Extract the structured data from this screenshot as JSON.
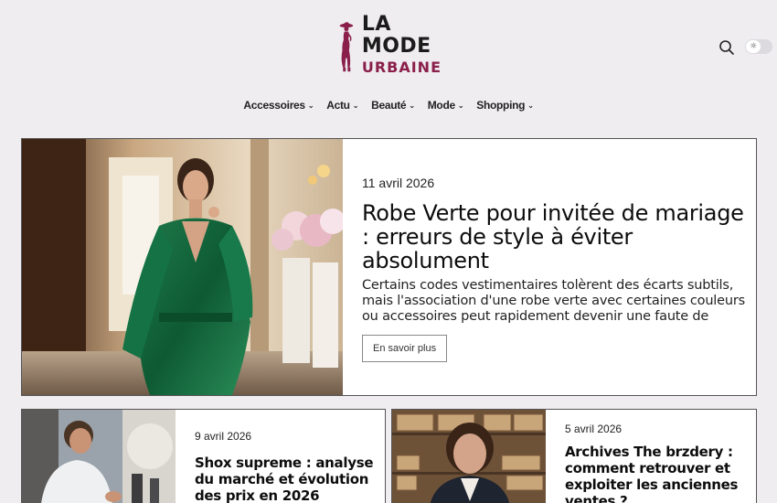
{
  "brand": {
    "line1": "LA",
    "line2": "MODE",
    "line3": "URBAINE",
    "accent_color": "#8a1f4b"
  },
  "header_actions": {
    "search_icon": "search-icon",
    "theme_icon": "sun-icon"
  },
  "nav": {
    "items": [
      {
        "label": "Accessoires"
      },
      {
        "label": "Actu"
      },
      {
        "label": "Beauté"
      },
      {
        "label": "Mode"
      },
      {
        "label": "Shopping"
      }
    ]
  },
  "featured": {
    "date": "11 avril 2026",
    "title": "Robe Verte pour invitée de mariage : erreurs de style à éviter absolument",
    "excerpt": "Certains codes vestimentaires tolèrent des écarts subtils, mais l'association d'une robe verte avec certaines couleurs ou accessoires peut rapidement devenir une faute de goût....",
    "button": "En savoir plus"
  },
  "posts": [
    {
      "date": "9 avril 2026",
      "title": "Shox supreme : analyse du marché et évolution des prix en 2026"
    },
    {
      "date": "5 avril 2026",
      "title": "Archives The brzdery : comment retrouver et exploiter les anciennes ventes ?"
    }
  ]
}
